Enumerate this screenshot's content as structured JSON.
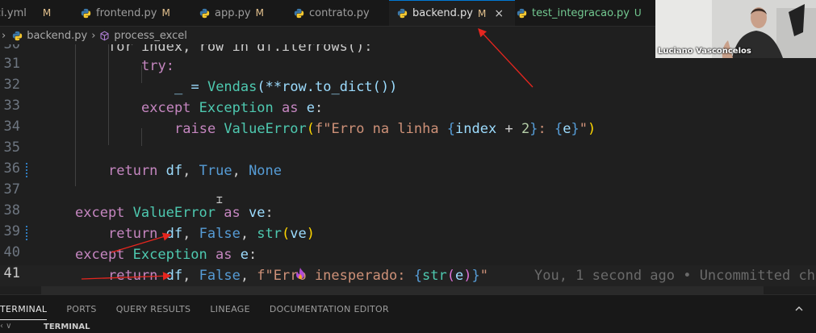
{
  "tabs": [
    {
      "label": "ci.yml",
      "status": "M",
      "icon": "yaml-icon"
    },
    {
      "label": "frontend.py",
      "status": "M",
      "icon": "python-icon"
    },
    {
      "label": "app.py",
      "status": "M",
      "icon": "python-icon"
    },
    {
      "label": "contrato.py",
      "status": "",
      "icon": "python-icon"
    },
    {
      "label": "backend.py",
      "status": "M",
      "icon": "python-icon",
      "active": true
    },
    {
      "label": "test_integracao.py",
      "status": "U",
      "icon": "python-icon"
    }
  ],
  "close_glyph": "×",
  "breadcrumb": {
    "separator": "›",
    "file": "backend.py",
    "symbol": "process_excel"
  },
  "editor": {
    "line_numbers": [
      "30",
      "31",
      "32",
      "33",
      "34",
      "35",
      "36",
      "37",
      "38",
      "39",
      "40",
      "41"
    ],
    "current_line": "41",
    "lines": {
      "l30": "for index, row in df.iterrows():",
      "l31": "try:",
      "l32_a": "_ = ",
      "l32_b": "Vendas",
      "l32_c": "(**row.to_dict())",
      "l33_a": "except ",
      "l33_b": "Exception",
      "l33_c": " as ",
      "l33_d": "e",
      "l33_e": ":",
      "l34_a": "raise ",
      "l34_b": "ValueError",
      "l34_c": "(",
      "l34_d": "f\"Erro na linha ",
      "l34_e": "{",
      "l34_f": "index",
      "l34_g": " + ",
      "l34_h": "2",
      "l34_i": "}",
      "l34_j": ": ",
      "l34_k": "{",
      "l34_l": "e",
      "l34_m": "}",
      "l34_n": "\"",
      "l34_o": ")",
      "l36_a": "return ",
      "l36_b": "df",
      "l36_c": ", ",
      "l36_d": "True",
      "l36_e": ", ",
      "l36_f": "None",
      "l38_a": "except ",
      "l38_b": "ValueError",
      "l38_c": " as ",
      "l38_d": "ve",
      "l38_e": ":",
      "l39_a": "return ",
      "l39_b": "df",
      "l39_c": ", ",
      "l39_d": "False",
      "l39_e": ", ",
      "l39_f": "str",
      "l39_g": "(",
      "l39_h": "ve",
      "l39_i": ")",
      "l40_a": "except ",
      "l40_b": "Exception",
      "l40_c": " as ",
      "l40_d": "e",
      "l40_e": ":",
      "l41_a": "return ",
      "l41_b": "df",
      "l41_c": ", ",
      "l41_d": "False",
      "l41_e": ", ",
      "l41_f": "f\"Erro inesperado: ",
      "l41_g": "{",
      "l41_h": "str",
      "l41_i": "(",
      "l41_j": "e",
      "l41_k": ")",
      "l41_l": "}",
      "l41_m": "\""
    },
    "blame": "You, 1 second ago • Uncommitted cha"
  },
  "panel": {
    "tabs": [
      {
        "label": "TERMINAL",
        "active": true
      },
      {
        "label": "PORTS"
      },
      {
        "label": "QUERY RESULTS"
      },
      {
        "label": "LINEAGE"
      },
      {
        "label": "DOCUMENTATION EDITOR"
      }
    ],
    "section_label": "TERMINAL"
  },
  "webcam": {
    "name": "Luciano Vasconcelos"
  },
  "colors": {
    "accent": "#0078d4",
    "modified": "#e2c08d",
    "untracked": "#73c991",
    "annotation_arrow": "#e5261f"
  }
}
